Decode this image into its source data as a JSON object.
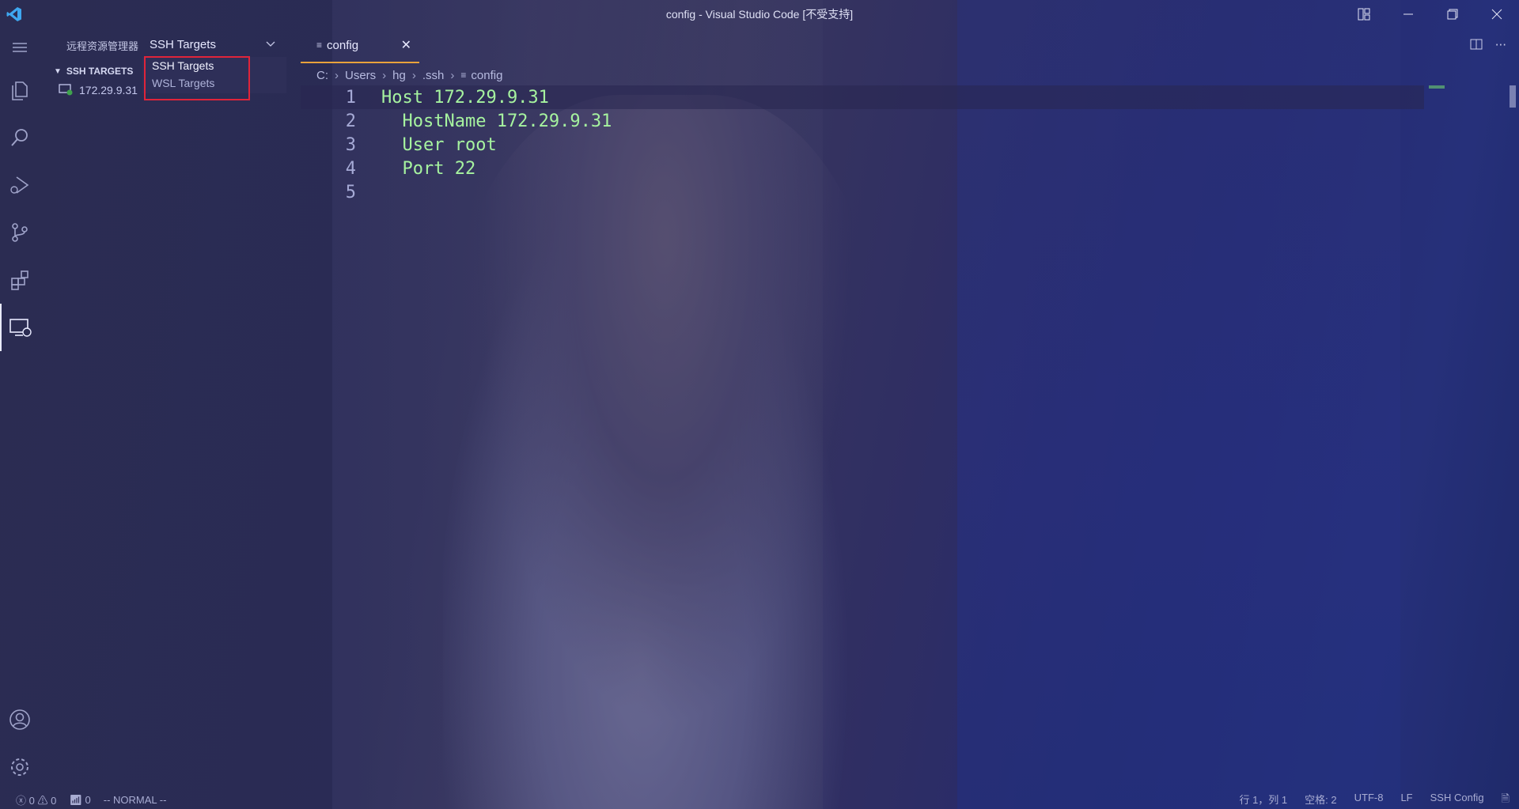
{
  "window": {
    "title": "config - Visual Studio Code [不受支持]",
    "logo_icon": "vscode-logo",
    "controls": {
      "layout_icon": "layout-icon",
      "minimize_icon": "minimize-icon",
      "restore_icon": "restore-icon",
      "close_icon": "close-icon"
    }
  },
  "activity_bar": {
    "items": [
      {
        "icon": "menu-icon"
      },
      {
        "icon": "files-icon"
      },
      {
        "icon": "search-icon"
      },
      {
        "icon": "run-debug-icon"
      },
      {
        "icon": "source-control-icon"
      },
      {
        "icon": "extensions-icon"
      },
      {
        "icon": "remote-explorer-icon",
        "active": true
      }
    ],
    "bottom": [
      {
        "icon": "account-icon"
      },
      {
        "icon": "gear-icon"
      }
    ]
  },
  "sidebar": {
    "header_label": "远程资源管理器",
    "selected": "SSH Targets",
    "section_title": "SSH TARGETS",
    "hosts": [
      {
        "label": "172.29.9.31"
      }
    ],
    "dropdown_options": [
      {
        "label": "SSH Targets",
        "selected": true
      },
      {
        "label": "WSL Targets",
        "selected": false
      }
    ]
  },
  "editor": {
    "tab": {
      "label": "config"
    },
    "breadcrumb": [
      "C:",
      "Users",
      "hg",
      ".ssh",
      "config"
    ],
    "lines": [
      {
        "n": "1",
        "text": "Host 172.29.9.31"
      },
      {
        "n": "2",
        "text": "  HostName 172.29.9.31"
      },
      {
        "n": "3",
        "text": "  User root"
      },
      {
        "n": "4",
        "text": "  Port 22"
      },
      {
        "n": "5",
        "text": ""
      }
    ]
  },
  "statusbar": {
    "errors": "0",
    "warnings": "0",
    "ports": "0",
    "mode": "-- NORMAL --",
    "position": "行 1，列 1",
    "spaces": "空格: 2",
    "encoding": "UTF-8",
    "eol": "LF",
    "language": "SSH Config"
  },
  "colors": {
    "accent": "#e9a23b",
    "highlight_box": "#e0243a",
    "code_text": "#a6f39f"
  }
}
